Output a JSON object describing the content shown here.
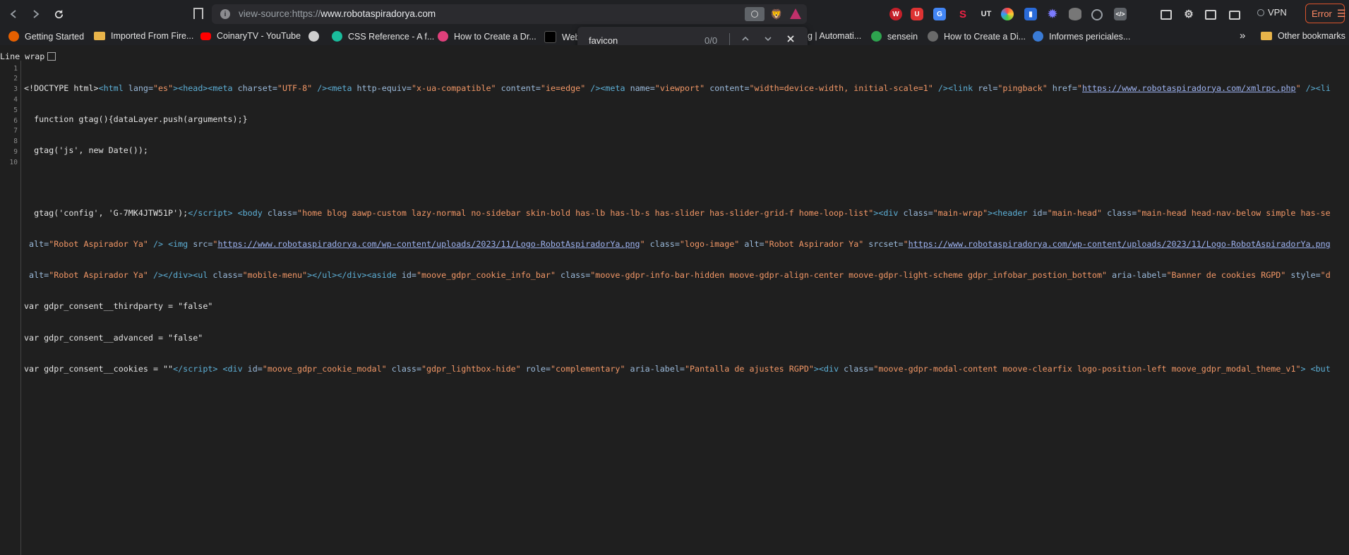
{
  "browser": {
    "url_scheme": "view-source:https://",
    "url_host": "www.robotaspiradorya.com",
    "vpn_label": "VPN",
    "error_label": "Error"
  },
  "bookmarks": [
    {
      "label": "Getting Started",
      "icon": "firefox-icon",
      "color": "#e66000"
    },
    {
      "label": "Imported From Fire...",
      "icon": "folder-icon",
      "color": "#e8b44a"
    },
    {
      "label": "CoinaryTV - YouTube",
      "icon": "youtube-icon",
      "color": "#ff0000"
    },
    {
      "label": "",
      "icon": "globe-icon",
      "color": "#cfcfcf"
    },
    {
      "label": "CSS Reference - A f...",
      "icon": "css-reference-icon",
      "color": "#1abc9c"
    },
    {
      "label": "How to Create a Dr...",
      "icon": "star-badge-icon",
      "color": "#e0407b"
    },
    {
      "label": "Web",
      "icon": "terminal-icon",
      "color": "#000000"
    },
    {
      "label": "g | Automati...",
      "icon": "",
      "color": ""
    },
    {
      "label": "sensein",
      "icon": "w-icon",
      "color": "#2ea44f"
    },
    {
      "label": "How to Create a Di...",
      "icon": "share-icon",
      "color": "#6a6a6a"
    },
    {
      "label": "Informes periciales...",
      "icon": "wordpress-icon",
      "color": "#3a7bd5"
    }
  ],
  "bookmarks_more": "»",
  "other_bookmarks": "Other bookmarks",
  "find": {
    "query": "favicon",
    "count": "0/0"
  },
  "source_view": {
    "line_wrap_label": "Line wrap",
    "line_numbers": [
      "1",
      "2",
      "3",
      "4",
      "5",
      "6",
      "7",
      "8",
      "9",
      "10"
    ]
  }
}
